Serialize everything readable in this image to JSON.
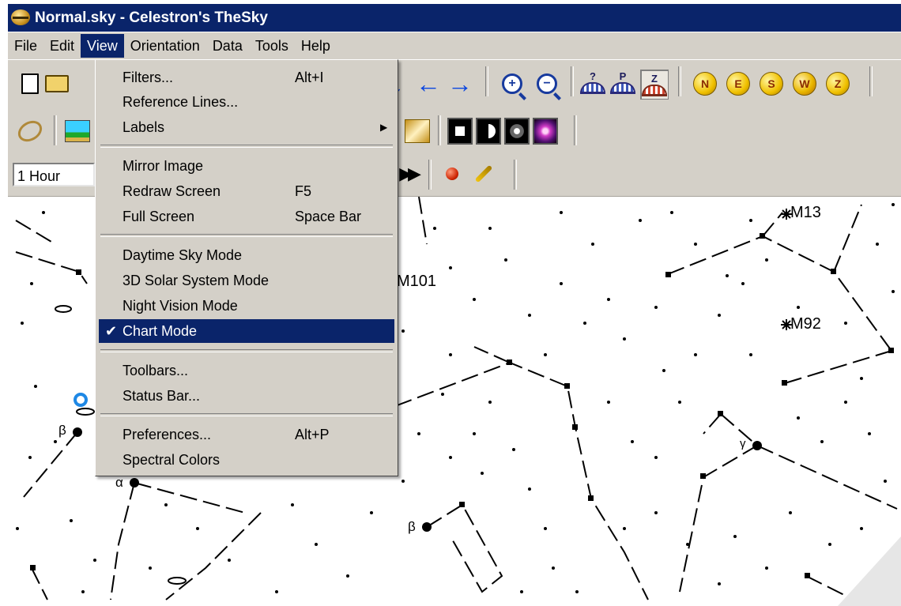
{
  "window": {
    "title": "Normal.sky - Celestron's TheSky"
  },
  "menubar": {
    "items": [
      "File",
      "Edit",
      "View",
      "Orientation",
      "Data",
      "Tools",
      "Help"
    ]
  },
  "toolbar": {
    "time_step": "1 Hour",
    "dome_letters": [
      "?",
      "P",
      "Z"
    ],
    "direction_letters": [
      "N",
      "E",
      "S",
      "W",
      "Z"
    ]
  },
  "view_menu": {
    "filters": {
      "label": "Filters...",
      "shortcut": "Alt+I"
    },
    "reference_lines": {
      "label": "Reference Lines..."
    },
    "labels": {
      "label": "Labels"
    },
    "mirror_image": {
      "label": "Mirror Image"
    },
    "redraw_screen": {
      "label": "Redraw Screen",
      "shortcut": "F5"
    },
    "full_screen": {
      "label": "Full Screen",
      "shortcut": "Space Bar"
    },
    "daytime_sky": {
      "label": "Daytime Sky Mode"
    },
    "solar_system_3d": {
      "label": "3D Solar System Mode"
    },
    "night_vision": {
      "label": "Night Vision Mode"
    },
    "chart_mode": {
      "label": "Chart Mode",
      "checked": true
    },
    "toolbars": {
      "label": "Toolbars..."
    },
    "status_bar": {
      "label": "Status Bar..."
    },
    "preferences": {
      "label": "Preferences...",
      "shortcut": "Alt+P"
    },
    "spectral_colors": {
      "label": "Spectral Colors"
    }
  },
  "sky_chart": {
    "labels": {
      "m13": "M13",
      "m92": "M92",
      "m101": "M101",
      "beta1": "β",
      "beta2": "β",
      "alpha": "α",
      "gamma": "γ"
    }
  },
  "colors": {
    "title_bar": "#0a246a",
    "menu_highlight": "#0a246a",
    "chrome": "#d4d0c8",
    "arrow_blue": "#0b46e0"
  }
}
